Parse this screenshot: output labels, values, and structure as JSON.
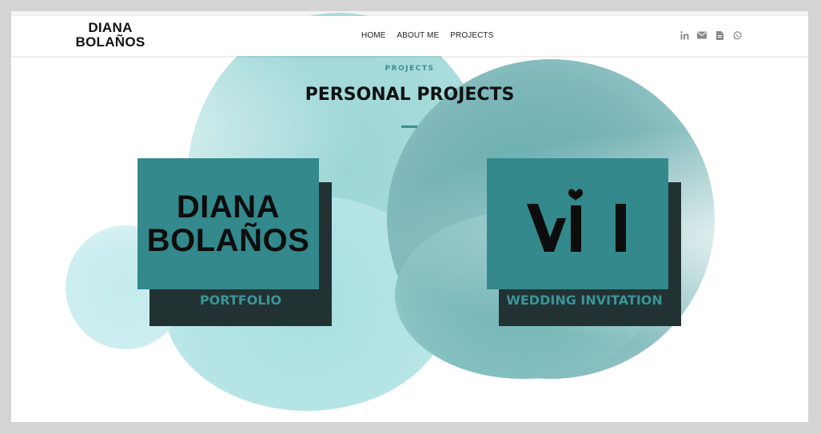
{
  "header": {
    "logo_line1": "DIANA",
    "logo_line2": "BOLAÑOS",
    "nav": [
      "HOME",
      "ABOUT ME",
      "PROJECTS"
    ],
    "social_icons": [
      "linkedin-icon",
      "envelope-icon",
      "document-icon",
      "whatsapp-icon"
    ]
  },
  "section": {
    "kicker": "PROJECTS",
    "title": "PERSONAL PROJECTS"
  },
  "projects": [
    {
      "logo_line1": "DIANA",
      "logo_line2": "BOLAÑOS",
      "label": "PORTFOLIO"
    },
    {
      "logo_text": "WI",
      "label": "WEDDING INVITATION"
    }
  ],
  "colors": {
    "accent": "#33898c",
    "card_shadow": "#223233",
    "label": "#3a9598"
  }
}
